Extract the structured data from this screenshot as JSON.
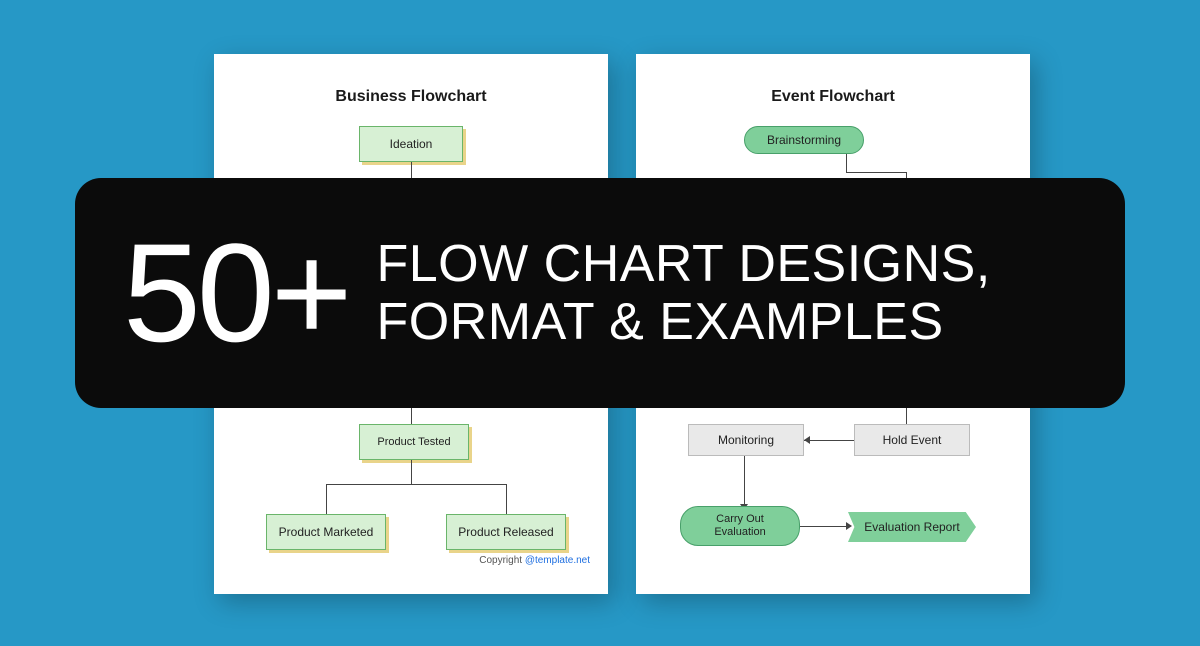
{
  "banner": {
    "number": "50+",
    "line1": "FLOW CHART DESIGNS,",
    "line2": "FORMAT & EXAMPLES"
  },
  "left_page": {
    "title": "Business Flowchart",
    "nodes": {
      "ideation": "Ideation",
      "tested": "Product Tested",
      "marketed": "Product Marketed",
      "released": "Product Released"
    },
    "copyright_label": "Copyright ",
    "copyright_link": "@template.net"
  },
  "right_page": {
    "title": "Event Flowchart",
    "nodes": {
      "brainstorming": "Brainstorming",
      "monitoring": "Monitoring",
      "hold_event": "Hold Event",
      "carry_out": "Carry Out Evaluation",
      "report": "Evaluation Report"
    }
  },
  "colors": {
    "bg": "#2698c6",
    "banner": "#0b0b0b",
    "node_green": "#d7f0d4",
    "pill_green": "#7fcf9a"
  }
}
